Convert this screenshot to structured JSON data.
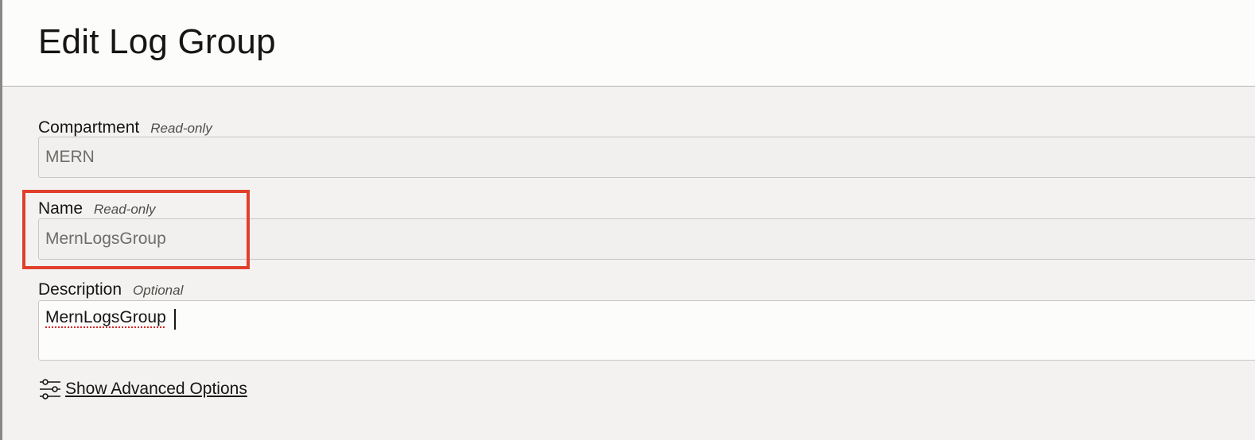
{
  "page": {
    "title": "Edit Log Group"
  },
  "form": {
    "compartment": {
      "label": "Compartment",
      "hint": "Read-only",
      "value": "MERN"
    },
    "name": {
      "label": "Name",
      "hint": "Read-only",
      "value": "MernLogsGroup"
    },
    "description": {
      "label": "Description",
      "hint": "Optional",
      "value": "MernLogsGroup"
    },
    "advanced_link": {
      "label": "Show Advanced Options",
      "icon": "sliders-icon"
    }
  },
  "colors": {
    "highlight": "#e0402b",
    "background": "#f3f2f1",
    "header": "#fcfcfb"
  }
}
